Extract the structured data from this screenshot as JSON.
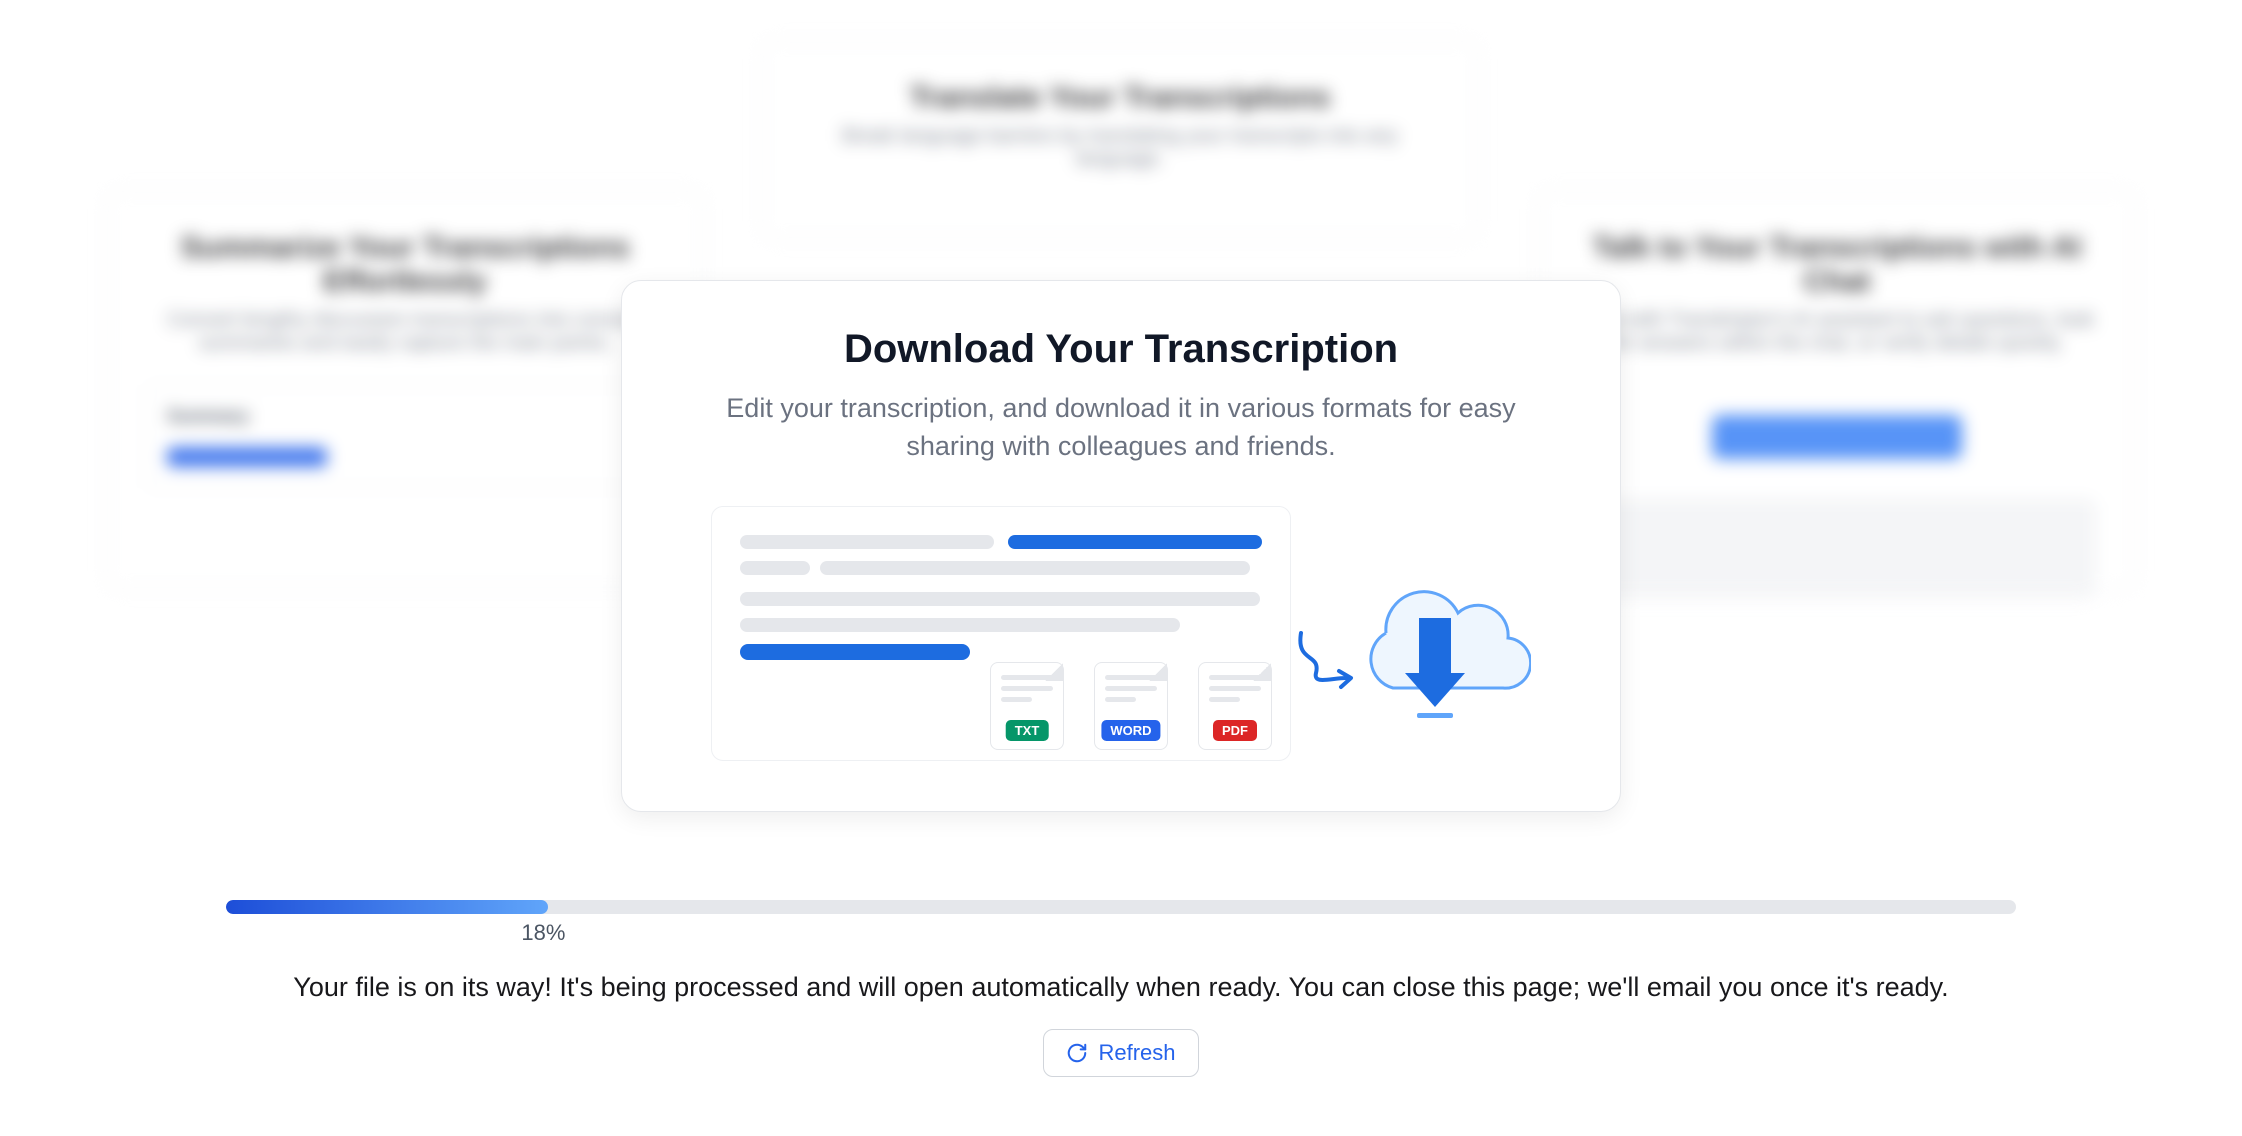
{
  "bg": {
    "top": {
      "title": "Translate Your Transcriptions",
      "sub": "Break language barriers by translating your transcripts into any language."
    },
    "left": {
      "title": "Summarize Your Transcriptions Effortlessly",
      "sub": "Convert lengthy discussion transcriptions into concise summaries and easily capture the main points.",
      "summary_label": "Summary"
    },
    "right": {
      "title": "Talk to Your Transcriptions with AI Chat",
      "sub": "Chat with Transkriptor's AI assistant to ask questions, look for answers within the chat, or verify details quickly."
    }
  },
  "card": {
    "title": "Download Your Transcription",
    "subtitle": "Edit your transcription, and download it in various formats for easy sharing with colleagues and friends.",
    "formats": {
      "txt": "TXT",
      "word": "WORD",
      "pdf": "PDF"
    }
  },
  "progress": {
    "percent_label": "18%",
    "percent_value": 18,
    "status": "Your file is on its way! It's being processed and will open automatically when ready. You can close this page; we'll email you once it's ready.",
    "refresh_label": "Refresh"
  }
}
